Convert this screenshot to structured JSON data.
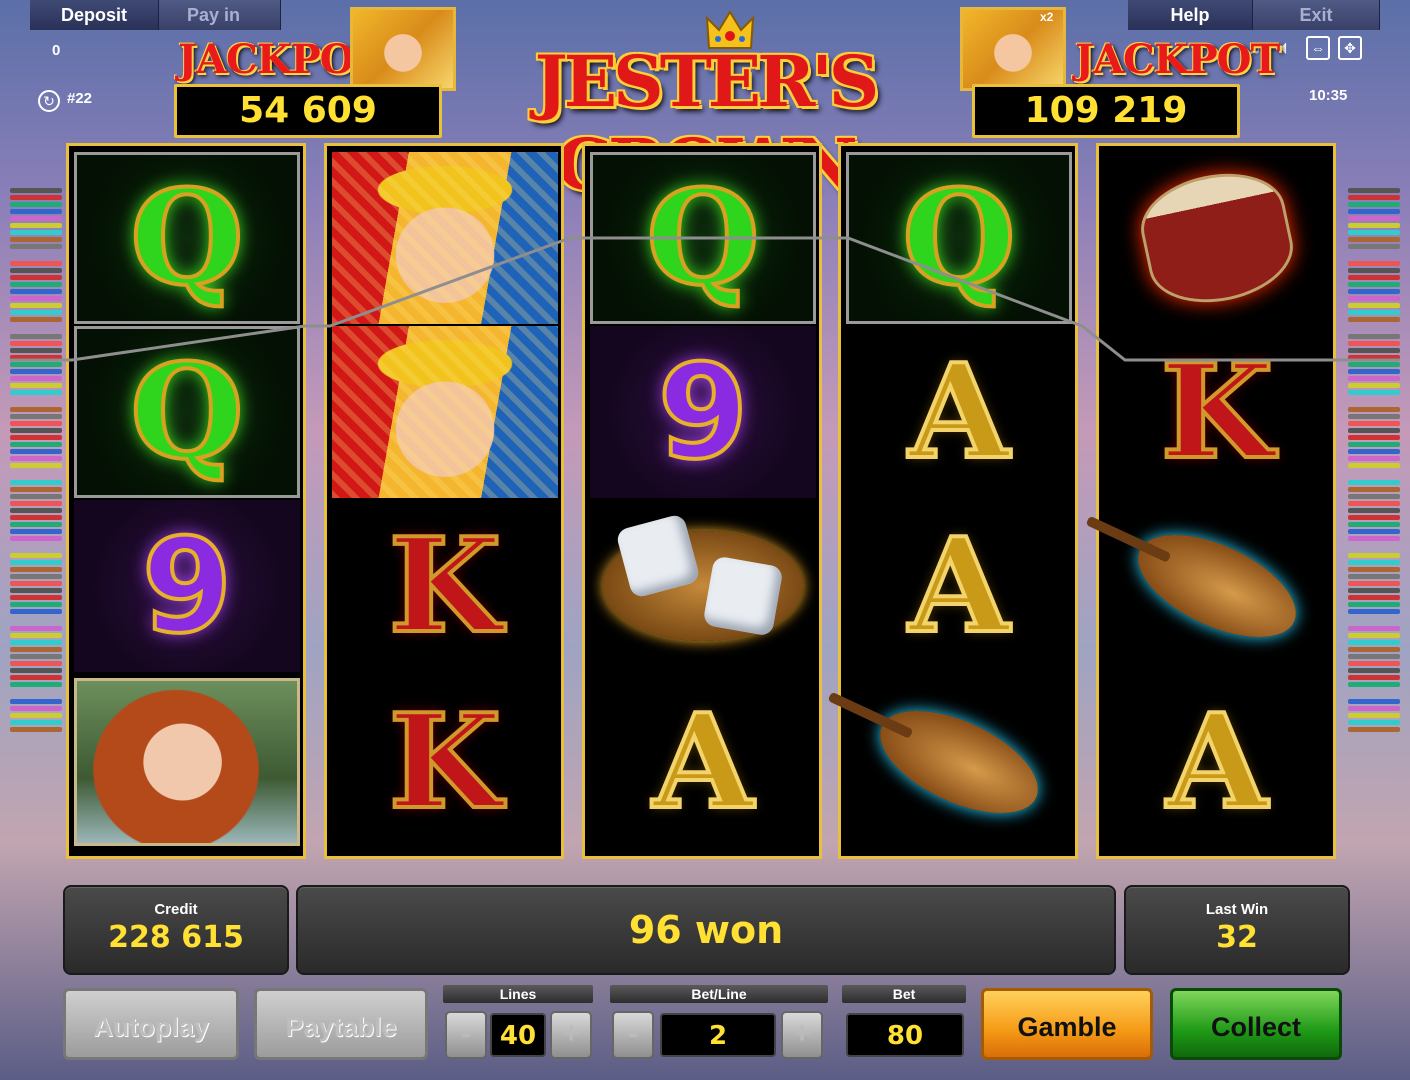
{
  "menu": {
    "deposit": "Deposit",
    "pay_in": "Pay in",
    "help": "Help",
    "exit": "Exit"
  },
  "status": {
    "balance": "0",
    "game_id": "#22",
    "clock": "10:35"
  },
  "jackpots": {
    "label": "JACKPOT",
    "left_value": "54 609",
    "right_value": "109 219",
    "right_multiplier": "x2"
  },
  "title": "JESTER'S CROWN",
  "reels": [
    [
      "Q",
      "Q",
      "9",
      "lady"
    ],
    [
      "jester",
      "jester",
      "K",
      "K"
    ],
    [
      "Q",
      "9",
      "dice",
      "A"
    ],
    [
      "Q",
      "A",
      "A",
      "lute"
    ],
    [
      "drum",
      "K",
      "lute",
      "A"
    ]
  ],
  "info": {
    "credit_label": "Credit",
    "credit_value": "228 615",
    "message": "96 won",
    "last_win_label": "Last Win",
    "last_win_value": "32"
  },
  "controls": {
    "autoplay": "Autoplay",
    "paytable": "Paytable",
    "lines_label": "Lines",
    "lines_value": "40",
    "bet_line_label": "Bet/Line",
    "bet_line_value": "2",
    "bet_label": "Bet",
    "bet_value": "80",
    "minus": "-",
    "plus": "+",
    "gamble": "Gamble",
    "collect": "Collect"
  },
  "icons": [
    "restart-icon",
    "music-icon",
    "sound-icon",
    "fullscreen-exit-icon",
    "fullscreen-icon"
  ],
  "colors": {
    "accent_gold": "#ffe033",
    "frame_gold": "#e8c03b",
    "jackpot_red": "#e81a1a"
  }
}
